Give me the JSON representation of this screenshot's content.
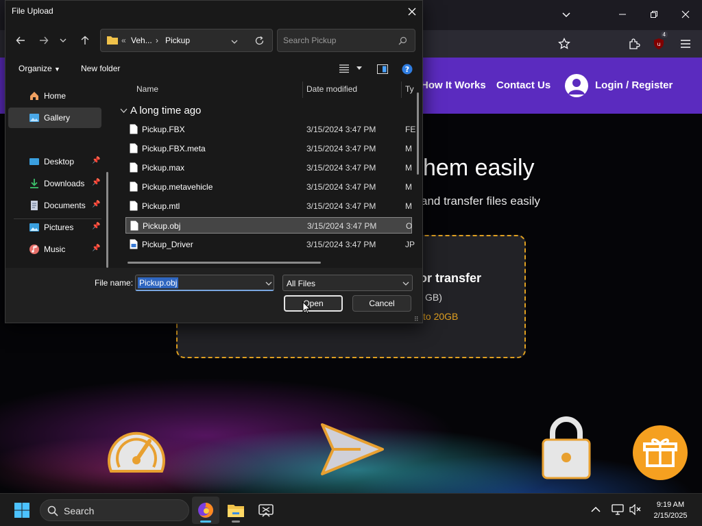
{
  "browser": {
    "extension_badge": "4"
  },
  "website": {
    "nav": {
      "how_it_works": "How It Works",
      "contact_us": "Contact Us",
      "login_register": "Login / Register"
    },
    "hero_title": "hem easily",
    "hero_subtitle": "and transfer files easily",
    "drop_zone": {
      "title": "or transfer",
      "size_text": "GB)",
      "limit_text": "to 20GB"
    },
    "colors": {
      "nav_bg": "#5b2bbf",
      "accent": "#e0a020"
    }
  },
  "dialog": {
    "title": "File Upload",
    "breadcrumb": {
      "root": "Veh...",
      "current": "Pickup"
    },
    "search_placeholder": "Search Pickup",
    "commands": {
      "organize": "Organize",
      "new_folder": "New folder"
    },
    "nav_pane": [
      {
        "label": "Home",
        "icon": "home-icon",
        "pinned": false,
        "selected": false
      },
      {
        "label": "Gallery",
        "icon": "gallery-icon",
        "pinned": false,
        "selected": true
      },
      {
        "label": "Desktop",
        "icon": "desktop-icon",
        "pinned": true,
        "selected": false
      },
      {
        "label": "Downloads",
        "icon": "download-icon",
        "pinned": true,
        "selected": false
      },
      {
        "label": "Documents",
        "icon": "documents-icon",
        "pinned": true,
        "selected": false
      },
      {
        "label": "Pictures",
        "icon": "pictures-icon",
        "pinned": true,
        "selected": false
      },
      {
        "label": "Music",
        "icon": "music-icon",
        "pinned": true,
        "selected": false
      }
    ],
    "columns": {
      "name": "Name",
      "date_modified": "Date modified",
      "type": "Ty"
    },
    "group_label": "A long time ago",
    "files": [
      {
        "name": "Pickup.FBX",
        "date": "3/15/2024 3:47 PM",
        "type": "FE",
        "selected": false
      },
      {
        "name": "Pickup.FBX.meta",
        "date": "3/15/2024 3:47 PM",
        "type": "M",
        "selected": false
      },
      {
        "name": "Pickup.max",
        "date": "3/15/2024 3:47 PM",
        "type": "M",
        "selected": false
      },
      {
        "name": "Pickup.metavehicle",
        "date": "3/15/2024 3:47 PM",
        "type": "M",
        "selected": false
      },
      {
        "name": "Pickup.mtl",
        "date": "3/15/2024 3:47 PM",
        "type": "M",
        "selected": false
      },
      {
        "name": "Pickup.obj",
        "date": "3/15/2024 3:47 PM",
        "type": "O",
        "selected": true
      },
      {
        "name": "Pickup_Driver",
        "date": "3/15/2024 3:47 PM",
        "type": "JP",
        "selected": false
      }
    ],
    "file_name_label": "File name:",
    "file_name_value": "Pickup.obj",
    "filter_value": "All Files",
    "open_label": "Open",
    "cancel_label": "Cancel"
  },
  "taskbar": {
    "search_placeholder": "Search",
    "time": "9:19 AM",
    "date": "2/15/2025"
  }
}
